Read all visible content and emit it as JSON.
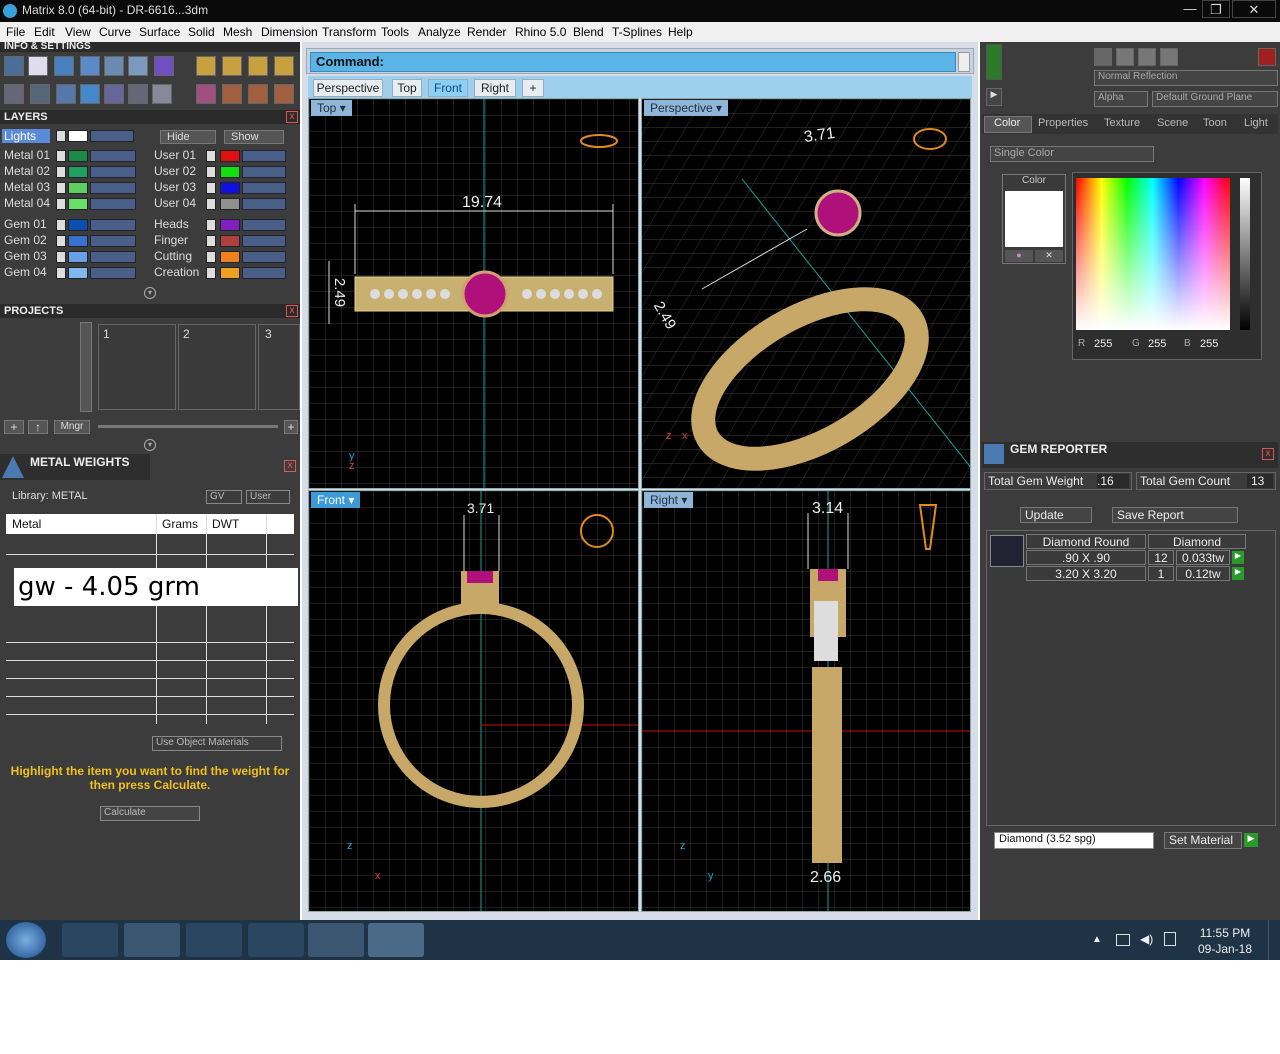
{
  "window": {
    "title": "Matrix 8.0 (64-bit) - DR-6616...3dm",
    "min": "—",
    "max": "❐",
    "close": "✕"
  },
  "menu": [
    "File",
    "Edit",
    "View",
    "Curve",
    "Surface",
    "Solid",
    "Mesh",
    "Dimension",
    "Transform",
    "Tools",
    "Analyze",
    "Render",
    "Rhino 5.0",
    "Blend",
    "T-Splines",
    "Help"
  ],
  "info_settings": {
    "title": "INFO & SETTINGS"
  },
  "layers": {
    "title": "LAYERS",
    "lights_label": "Lights",
    "hide_label": "Hide",
    "show_label": "Show",
    "left": [
      {
        "name": "Metal 01",
        "color": "#1e8a4a"
      },
      {
        "name": "Metal 02",
        "color": "#1ea060"
      },
      {
        "name": "Metal 03",
        "color": "#5fd05f"
      },
      {
        "name": "Metal 04",
        "color": "#6ae06a"
      },
      {
        "name": "Gem 01",
        "color": "#0a4fb0"
      },
      {
        "name": "Gem 02",
        "color": "#3a70d0"
      },
      {
        "name": "Gem 03",
        "color": "#6aa0e8"
      },
      {
        "name": "Gem 04",
        "color": "#80b8f0"
      }
    ],
    "right": [
      {
        "name": "User 01",
        "color": "#e01010"
      },
      {
        "name": "User 02",
        "color": "#10e010"
      },
      {
        "name": "User 03",
        "color": "#1010e0"
      },
      {
        "name": "User 04",
        "color": "#909090"
      },
      {
        "name": "Heads",
        "color": "#8020c0"
      },
      {
        "name": "Finger",
        "color": "#b04040"
      },
      {
        "name": "Cutting",
        "color": "#f08020"
      },
      {
        "name": "Creation",
        "color": "#f0a020"
      }
    ]
  },
  "projects": {
    "title": "PROJECTS",
    "slots": [
      "1",
      "2",
      "3"
    ],
    "mngr": "Mngr"
  },
  "metal_weights": {
    "title": "METAL WEIGHTS",
    "library": "Library: METAL",
    "gv": "GV",
    "user": "User",
    "columns": [
      "Metal",
      "Grams",
      "DWT"
    ],
    "overlay": "gw - 4.05 grm",
    "use_object_materials": "Use Object Materials",
    "hint": "Highlight the item you want to find the weight for then press Calculate.",
    "calculate": "Calculate"
  },
  "command": {
    "label": "Command:"
  },
  "view_tabs": [
    "Perspective",
    "Top",
    "Front",
    "Right",
    "+"
  ],
  "viewports": {
    "top": {
      "label": "Top",
      "dim_width": "19.74",
      "dim_height": "2.49"
    },
    "perspective": {
      "label": "Perspective",
      "dim_a": "3.71",
      "dim_b": "2.49"
    },
    "front": {
      "label": "Front",
      "dim_a": "3.71"
    },
    "right": {
      "label": "Right",
      "dim_top": "3.14",
      "dim_bottom": "2.66"
    }
  },
  "render": {
    "reflection": "Normal Reflection",
    "alpha": "Alpha",
    "ground": "Default Ground Plane"
  },
  "color_panel": {
    "tabs": [
      "Color",
      "Properties",
      "Texture",
      "Scene",
      "Toon",
      "Light"
    ],
    "mode": "Single Color",
    "swatch_label": "Color",
    "r_label": "R",
    "r": "255",
    "g_label": "G",
    "g": "255",
    "b_label": "B",
    "b": "255"
  },
  "gem_reporter": {
    "title": "GEM REPORTER",
    "total_weight_label": "Total Gem Weight",
    "total_weight": ".16",
    "total_count_label": "Total Gem Count",
    "total_count": "13",
    "update": "Update",
    "save_report": "Save Report",
    "headers": [
      "Diamond Round",
      "Diamond"
    ],
    "rows": [
      {
        "size": ".90 X .90",
        "count": "12",
        "weight": "0.033tw"
      },
      {
        "size": "3.20 X 3.20",
        "count": "1",
        "weight": "0.12tw"
      }
    ],
    "material": "Diamond    (3.52 spg)",
    "set_material": "Set Material"
  },
  "taskbar": {
    "time": "11:55 PM",
    "date": "09-Jan-18"
  }
}
